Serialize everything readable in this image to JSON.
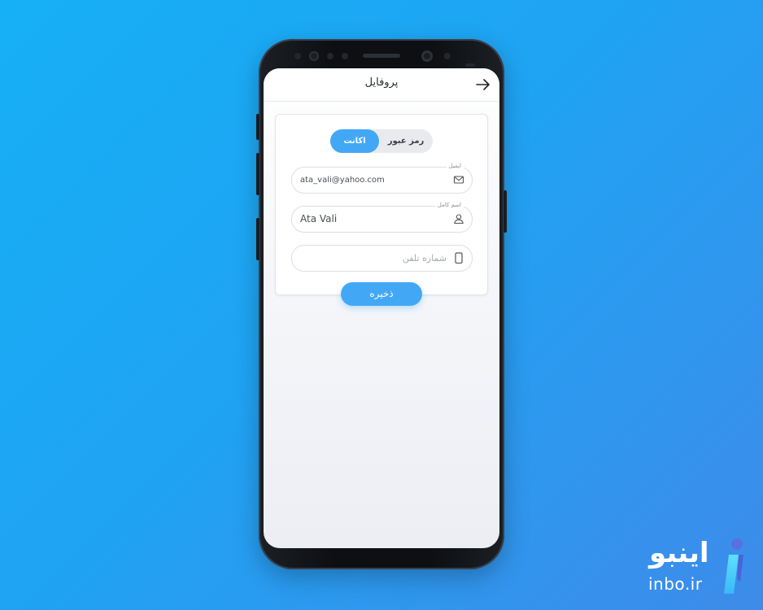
{
  "header": {
    "title": "پروفایل"
  },
  "tabs": [
    {
      "label": "اکانت",
      "active": true
    },
    {
      "label": "رمز عبور",
      "active": false
    }
  ],
  "form": {
    "email": {
      "label": "ایمیل",
      "value": "ata_vali@yahoo.com",
      "icon": "envelope-icon"
    },
    "full_name": {
      "label": "اسم کامل",
      "value": "Ata Vali",
      "icon": "user-icon"
    },
    "phone": {
      "placeholder": "شماره تلفن",
      "icon": "mobile-phone-icon"
    }
  },
  "save_button": {
    "label": "ذخیره"
  },
  "brand": {
    "name_fa": "اینبو",
    "domain": "inbo.ir"
  },
  "colors": {
    "accent": "#42a8f6",
    "background_start": "#16b0f6",
    "background_end": "#3e8bea"
  }
}
